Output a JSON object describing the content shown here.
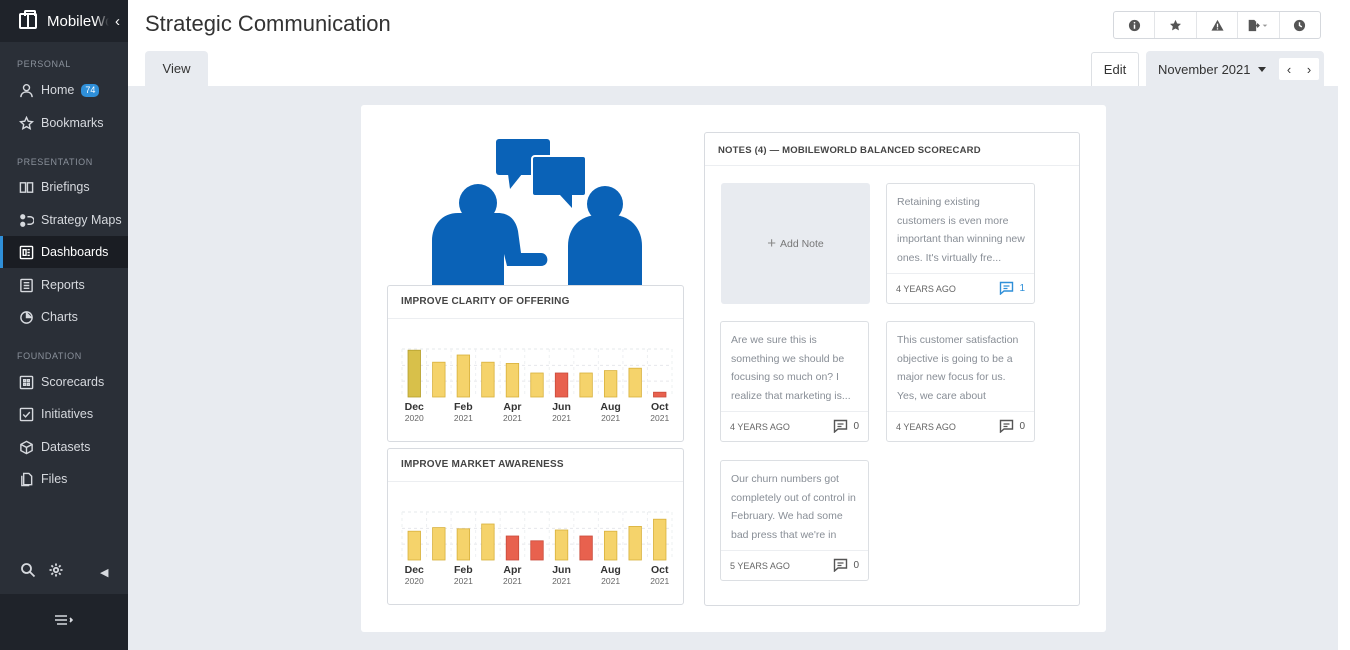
{
  "app": {
    "name": "MobileWorld"
  },
  "sidebar": {
    "sections": [
      "PERSONAL",
      "PRESENTATION",
      "FOUNDATION"
    ],
    "items": [
      {
        "label": "Home",
        "badge": "74",
        "icon": "person-icon"
      },
      {
        "label": "Bookmarks",
        "icon": "star-icon"
      },
      {
        "label": "Briefings",
        "icon": "book-icon"
      },
      {
        "label": "Strategy Maps",
        "icon": "strategy-map-icon"
      },
      {
        "label": "Dashboards",
        "icon": "dashboard-icon",
        "active": true
      },
      {
        "label": "Reports",
        "icon": "report-icon"
      },
      {
        "label": "Charts",
        "icon": "pie-chart-icon"
      },
      {
        "label": "Scorecards",
        "icon": "scorecard-icon"
      },
      {
        "label": "Initiatives",
        "icon": "checkbox-icon"
      },
      {
        "label": "Datasets",
        "icon": "cube-icon"
      },
      {
        "label": "Files",
        "icon": "files-icon"
      }
    ]
  },
  "header": {
    "title": "Strategic Communication",
    "tab": "View",
    "edit_label": "Edit",
    "period": "November 2021",
    "toolbar_icons": [
      "info-icon",
      "star-icon",
      "warning-icon",
      "export-icon",
      "clock-icon"
    ]
  },
  "colors": {
    "accent": "#2f8fd8",
    "bar_yellow": "#f5d36b",
    "bar_olive": "#d8c04a",
    "bar_red": "#e8614e",
    "illustration": "#0a62b7"
  },
  "chart_data": [
    {
      "type": "bar",
      "title": "IMPROVE CLARITY OF OFFERING",
      "categories": [
        "Dec 2020",
        "Jan 2021",
        "Feb 2021",
        "Mar 2021",
        "Apr 2021",
        "May 2021",
        "Jun 2021",
        "Jul 2021",
        "Aug 2021",
        "Sep 2021",
        "Oct 2021"
      ],
      "tick_labels": [
        {
          "month": "Dec",
          "year": "2020"
        },
        {
          "month": "Feb",
          "year": "2021"
        },
        {
          "month": "Apr",
          "year": "2021"
        },
        {
          "month": "Jun",
          "year": "2021"
        },
        {
          "month": "Aug",
          "year": "2021"
        },
        {
          "month": "Oct",
          "year": "2021"
        }
      ],
      "values": [
        39,
        29,
        35,
        29,
        28,
        20,
        20,
        20,
        22,
        24,
        4
      ],
      "status": [
        "olive",
        "yellow",
        "yellow",
        "yellow",
        "yellow",
        "yellow",
        "red",
        "yellow",
        "yellow",
        "yellow",
        "red"
      ]
    },
    {
      "type": "bar",
      "title": "IMPROVE MARKET AWARENESS",
      "categories": [
        "Dec 2020",
        "Jan 2021",
        "Feb 2021",
        "Mar 2021",
        "Apr 2021",
        "May 2021",
        "Jun 2021",
        "Jul 2021",
        "Aug 2021",
        "Sep 2021",
        "Oct 2021"
      ],
      "tick_labels": [
        {
          "month": "Dec",
          "year": "2020"
        },
        {
          "month": "Feb",
          "year": "2021"
        },
        {
          "month": "Apr",
          "year": "2021"
        },
        {
          "month": "Jun",
          "year": "2021"
        },
        {
          "month": "Aug",
          "year": "2021"
        },
        {
          "month": "Oct",
          "year": "2021"
        }
      ],
      "values": [
        24,
        27,
        26,
        30,
        20,
        16,
        25,
        20,
        24,
        28,
        34
      ],
      "status": [
        "yellow",
        "yellow",
        "yellow",
        "yellow",
        "red",
        "red",
        "yellow",
        "red",
        "yellow",
        "yellow",
        "yellow"
      ]
    }
  ],
  "notes": {
    "title": "NOTES (4) — MOBILEWORLD BALANCED SCORECARD",
    "add_label": "Add Note",
    "items": [
      {
        "text": "Retaining existing customers is even more important than winning new ones. It's virtually fre...",
        "age": "4 YEARS AGO",
        "comments": "1"
      },
      {
        "text": "Are we sure this is something we should be focusing so much on? I realize that marketing is...",
        "age": "4 YEARS AGO",
        "comments": "0"
      },
      {
        "text": "This customer satisfaction objective is going to be a major new focus for us. Yes, we care about revenue, b...",
        "age": "4 YEARS AGO",
        "comments": "0"
      },
      {
        "text": "Our churn numbers got completely out of control in February. We had some bad press that we're in the...",
        "age": "5 YEARS AGO",
        "comments": "0"
      }
    ]
  }
}
